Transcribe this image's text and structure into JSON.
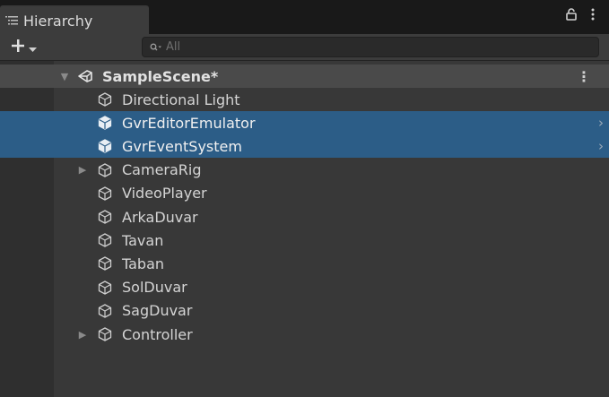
{
  "panel": {
    "tab_title": "Hierarchy",
    "search_placeholder": "All",
    "add_label": "+"
  },
  "scene": {
    "name": "SampleScene*"
  },
  "items": [
    {
      "label": "Directional Light",
      "selected": false,
      "expandable": false
    },
    {
      "label": "GvrEditorEmulator",
      "selected": true,
      "expandable": false
    },
    {
      "label": "GvrEventSystem",
      "selected": true,
      "expandable": false
    },
    {
      "label": "CameraRig",
      "selected": false,
      "expandable": true
    },
    {
      "label": "VideoPlayer",
      "selected": false,
      "expandable": false
    },
    {
      "label": "ArkaDuvar",
      "selected": false,
      "expandable": false
    },
    {
      "label": "Tavan",
      "selected": false,
      "expandable": false
    },
    {
      "label": "Taban",
      "selected": false,
      "expandable": false
    },
    {
      "label": "SolDuvar",
      "selected": false,
      "expandable": false
    },
    {
      "label": "SagDuvar",
      "selected": false,
      "expandable": false
    },
    {
      "label": "Controller",
      "selected": false,
      "expandable": true
    }
  ],
  "colors": {
    "selection": "#2c5d87",
    "panel_bg": "#383838",
    "toolbar_bg": "#3c3c3c"
  },
  "icons": {
    "tab": "hierarchy-list-icon",
    "lock": "lock-icon",
    "menu": "kebab-menu-icon",
    "add": "plus-icon",
    "dropdown": "caret-down-icon",
    "search": "search-icon",
    "scene": "unity-scene-icon",
    "object": "cube-icon"
  }
}
